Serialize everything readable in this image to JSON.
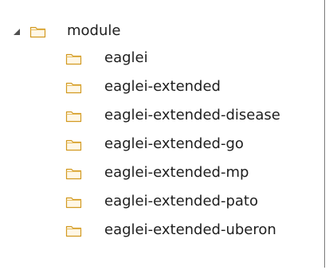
{
  "tree": {
    "root": {
      "label": "module",
      "expanded": true,
      "icon": "folder-icon",
      "twisty_icon": "expanded-triangle-icon"
    },
    "children": [
      {
        "label": "eaglei",
        "icon": "folder-icon"
      },
      {
        "label": "eaglei-extended",
        "icon": "folder-icon"
      },
      {
        "label": "eaglei-extended-disease",
        "icon": "folder-icon"
      },
      {
        "label": "eaglei-extended-go",
        "icon": "folder-icon"
      },
      {
        "label": "eaglei-extended-mp",
        "icon": "folder-icon"
      },
      {
        "label": "eaglei-extended-pato",
        "icon": "folder-icon"
      },
      {
        "label": "eaglei-extended-uberon",
        "icon": "folder-icon"
      }
    ]
  },
  "colors": {
    "panel_border": "#7a7a7a",
    "text": "#1e1e1e",
    "folder_outline": "#d29a22",
    "folder_fill": "#fff7e6",
    "twisty": "#505050"
  }
}
